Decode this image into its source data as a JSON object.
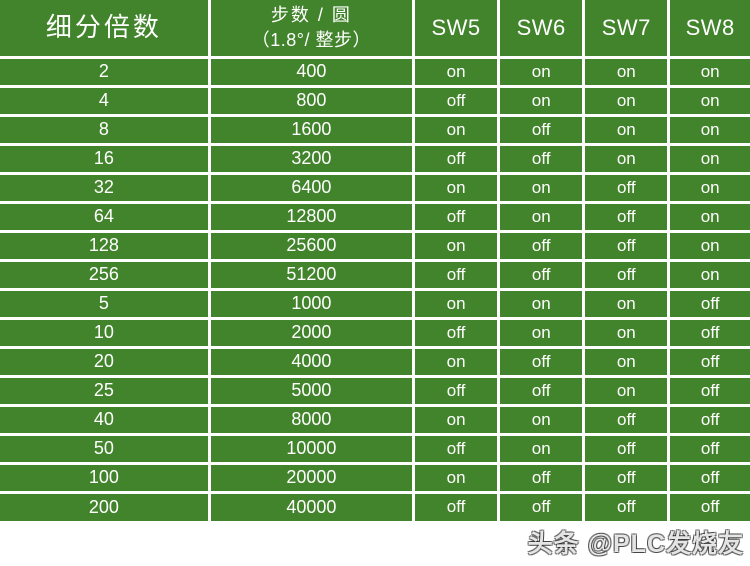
{
  "table": {
    "headers": {
      "microstep": "细分倍数",
      "steps_line1": "步数 / 圆",
      "steps_line2": "（1.8°/ 整步）",
      "sw5": "SW5",
      "sw6": "SW6",
      "sw7": "SW7",
      "sw8": "SW8"
    },
    "rows": [
      {
        "microstep": "2",
        "steps": "400",
        "sw5": "on",
        "sw6": "on",
        "sw7": "on",
        "sw8": "on"
      },
      {
        "microstep": "4",
        "steps": "800",
        "sw5": "off",
        "sw6": "on",
        "sw7": "on",
        "sw8": "on"
      },
      {
        "microstep": "8",
        "steps": "1600",
        "sw5": "on",
        "sw6": "off",
        "sw7": "on",
        "sw8": "on"
      },
      {
        "microstep": "16",
        "steps": "3200",
        "sw5": "off",
        "sw6": "off",
        "sw7": "on",
        "sw8": "on"
      },
      {
        "microstep": "32",
        "steps": "6400",
        "sw5": "on",
        "sw6": "on",
        "sw7": "off",
        "sw8": "on"
      },
      {
        "microstep": "64",
        "steps": "12800",
        "sw5": "off",
        "sw6": "on",
        "sw7": "off",
        "sw8": "on"
      },
      {
        "microstep": "128",
        "steps": "25600",
        "sw5": "on",
        "sw6": "off",
        "sw7": "off",
        "sw8": "on"
      },
      {
        "microstep": "256",
        "steps": "51200",
        "sw5": "off",
        "sw6": "off",
        "sw7": "off",
        "sw8": "on"
      },
      {
        "microstep": "5",
        "steps": "1000",
        "sw5": "on",
        "sw6": "on",
        "sw7": "on",
        "sw8": "off"
      },
      {
        "microstep": "10",
        "steps": "2000",
        "sw5": "off",
        "sw6": "on",
        "sw7": "on",
        "sw8": "off"
      },
      {
        "microstep": "20",
        "steps": "4000",
        "sw5": "on",
        "sw6": "off",
        "sw7": "on",
        "sw8": "off"
      },
      {
        "microstep": "25",
        "steps": "5000",
        "sw5": "off",
        "sw6": "off",
        "sw7": "on",
        "sw8": "off"
      },
      {
        "microstep": "40",
        "steps": "8000",
        "sw5": "on",
        "sw6": "on",
        "sw7": "off",
        "sw8": "off"
      },
      {
        "microstep": "50",
        "steps": "10000",
        "sw5": "off",
        "sw6": "on",
        "sw7": "off",
        "sw8": "off"
      },
      {
        "microstep": "100",
        "steps": "20000",
        "sw5": "on",
        "sw6": "off",
        "sw7": "off",
        "sw8": "off"
      },
      {
        "microstep": "200",
        "steps": "40000",
        "sw5": "off",
        "sw6": "off",
        "sw7": "off",
        "sw8": "off"
      }
    ]
  },
  "watermark": {
    "text": "头条 @PLC发烧友"
  },
  "colors": {
    "cell_green": "#42842b",
    "header_green": "#458b2c",
    "grid_white": "#ffffff",
    "text_white": "#ffffff"
  }
}
